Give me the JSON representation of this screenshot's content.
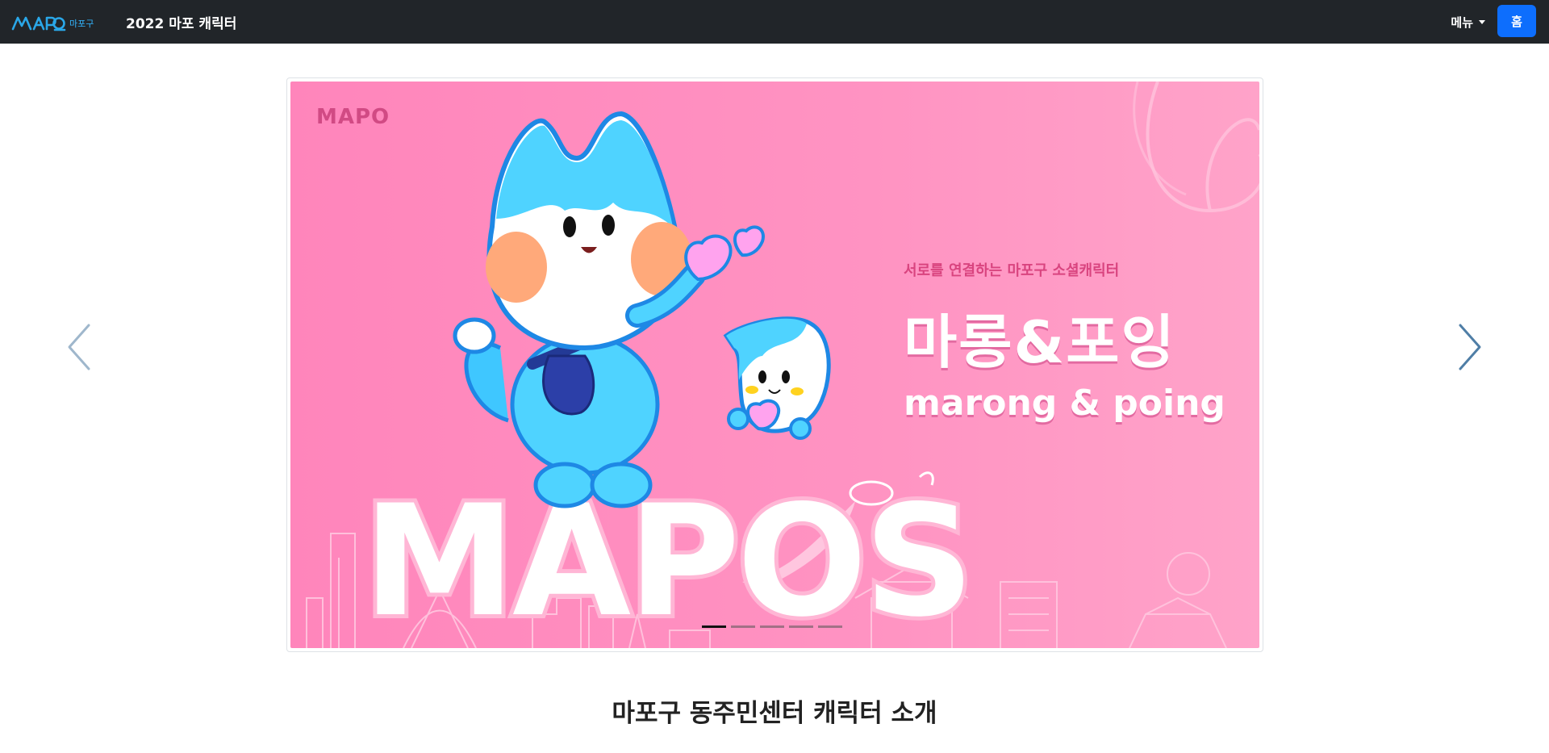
{
  "navbar": {
    "logo_text": "MAPO",
    "logo_sub": "마포구",
    "title": "2022 마포 캐릭터",
    "menu_label": "메뉴",
    "home_label": "홈"
  },
  "carousel": {
    "slide": {
      "logo_text": "MAPO",
      "tagline": "서로를 연결하는 마포구 소셜캐릭터",
      "title_ko": "마롱&포잉",
      "title_en": "marong & poing",
      "big_text": "MAPOS"
    },
    "slide_count": 5,
    "active_index": 0,
    "prev_icon": "chevron-left-icon",
    "next_icon": "chevron-right-icon"
  },
  "section": {
    "title": "마포구 동주민센터 캐릭터 소개"
  },
  "colors": {
    "navbar_bg": "#212529",
    "home_button": "#0d6efd",
    "slide_pink": "#ff8fbf",
    "character_blue": "#4fd3ff",
    "tagline": "#d9447f"
  }
}
